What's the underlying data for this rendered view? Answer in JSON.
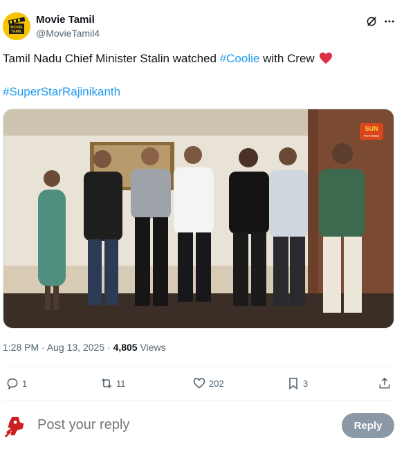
{
  "author": {
    "name": "Movie Tamil",
    "handle": "@MovieTamil4",
    "avatar_text": "MOVIE TAMIL"
  },
  "tweet": {
    "text_before": "Tamil Nadu Chief Minister Stalin watched ",
    "hashtag1": "#Coolie",
    "text_after": " with Crew",
    "hashtag2": "#SuperStarRajinikanth",
    "emoji": "red-heart"
  },
  "photo": {
    "logo_text": "SUN",
    "logo_subtext": "PICTURES"
  },
  "meta": {
    "time": "1:28 PM",
    "separator": " · ",
    "date": "Aug 13, 2025",
    "views_count": "4,805",
    "views_label": " Views"
  },
  "actions": {
    "replies": "1",
    "reposts": "11",
    "likes": "202",
    "bookmarks": "3"
  },
  "reply": {
    "placeholder": "Post your reply",
    "button_label": "Reply"
  },
  "colors": {
    "accent": "#1d9bf0",
    "secondary_text": "#536471",
    "reply_button": "#8b98a5",
    "avatar_bg": "#f5c400"
  }
}
